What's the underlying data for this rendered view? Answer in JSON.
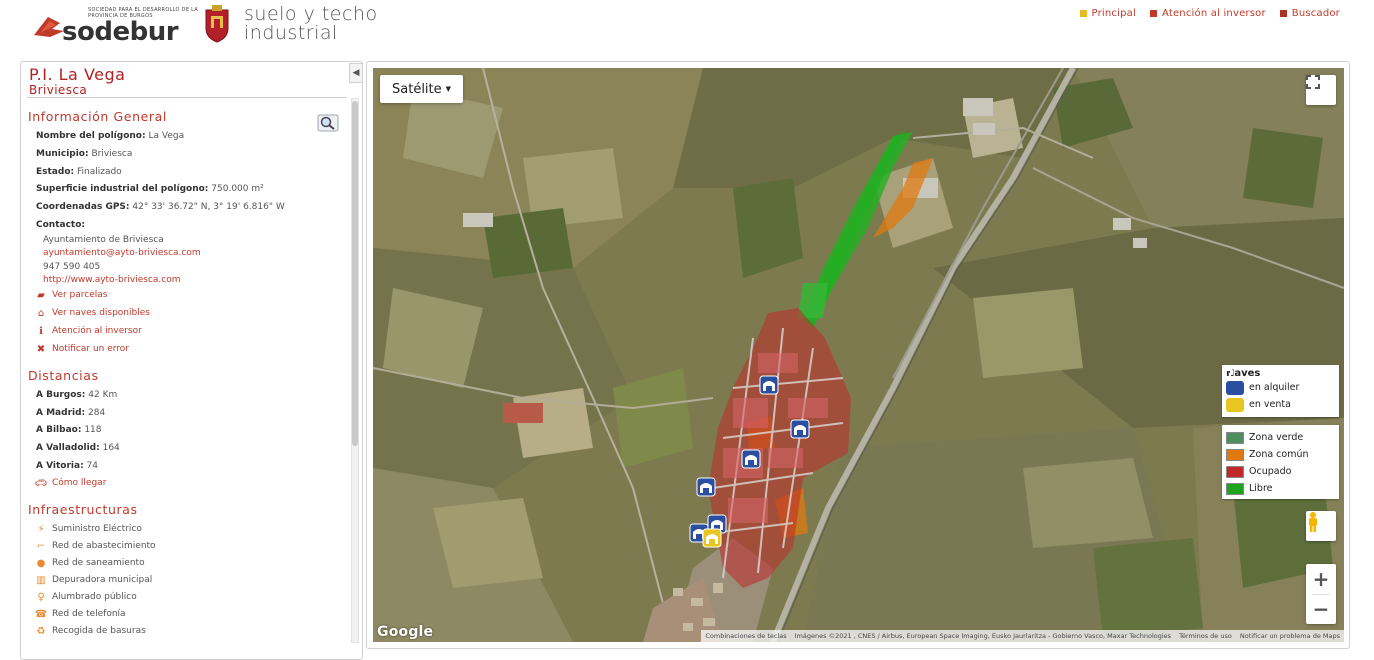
{
  "header": {
    "logo_tagline": "Sociedad para el desarrollo de la provincia de Burgos",
    "logo_word": "sodebur",
    "app_title_line1": "suelo y techo",
    "app_title_line2": "industrial",
    "nav": [
      {
        "label": "Principal",
        "color": "#e8b923"
      },
      {
        "label": "Atención al inversor",
        "color": "#c0392b"
      },
      {
        "label": "Buscador",
        "color": "#a93226"
      }
    ]
  },
  "sidebar": {
    "title": "P.I. La Vega",
    "subtitle": "Briviesca",
    "general": {
      "heading": "Información General",
      "rows": [
        {
          "label": "Nombre del polígono:",
          "value": "La Vega"
        },
        {
          "label": "Municipio:",
          "value": "Briviesca"
        },
        {
          "label": "Estado:",
          "value": "Finalizado"
        },
        {
          "label": "Superficie industrial del polígono:",
          "value": "750.000 m²"
        },
        {
          "label": "Coordenadas GPS:",
          "value": "42° 33' 36.72\" N, 3° 19' 6.816\" W"
        }
      ],
      "contact_label": "Contacto:",
      "contact": {
        "name": "Ayuntamiento de Briviesca",
        "email": "ayuntamiento@ayto-briviesca.com",
        "phone": "947 590 405",
        "web": "http://www.ayto-briviesca.com"
      },
      "actions": [
        {
          "label": "Ver parcelas",
          "icon": "parcel-icon"
        },
        {
          "label": "Ver naves disponibles",
          "icon": "warehouse-icon"
        },
        {
          "label": "Atención al inversor",
          "icon": "info-icon"
        },
        {
          "label": "Notificar un error",
          "icon": "close-icon"
        }
      ]
    },
    "distances": {
      "heading": "Distancias",
      "rows": [
        {
          "label": "A Burgos:",
          "value": "42 Km"
        },
        {
          "label": "A Madrid:",
          "value": "284"
        },
        {
          "label": "A Bilbao:",
          "value": "118"
        },
        {
          "label": "A Valladolid:",
          "value": "164"
        },
        {
          "label": "A Vitoria:",
          "value": "74"
        }
      ],
      "route_label": "Cómo llegar"
    },
    "infra": {
      "heading": "Infraestructuras",
      "items": [
        "Suministro Eléctrico",
        "Red de abastecimiento",
        "Red de saneamiento",
        "Depuradora municipal",
        "Alumbrado público",
        "Red de telefonía",
        "Recogida de basuras"
      ]
    }
  },
  "map": {
    "type_button": "Satélite",
    "brand": "Google",
    "attribution": [
      "Combinaciones de teclas",
      "Imágenes ©2021 , CNES / Airbus, European Space Imaging, Eusko Jaurlaritza - Gobierno Vasco, Maxar Technologies",
      "Términos de uso",
      "Notificar un problema de Maps"
    ],
    "legend_naves": {
      "title": "Naves",
      "items": [
        {
          "label": "en alquiler",
          "color": "#2a4fa0"
        },
        {
          "label": "en venta",
          "color": "#e8c61f"
        }
      ]
    },
    "legend_zones": [
      {
        "label": "Zona verde",
        "color": "#4f8f5f"
      },
      {
        "label": "Zona común",
        "color": "#e07a10"
      },
      {
        "label": "Ocupado",
        "color": "#c0292a"
      },
      {
        "label": "Libre",
        "color": "#1fa31f"
      }
    ],
    "zoom_in": "+",
    "zoom_out": "−"
  }
}
